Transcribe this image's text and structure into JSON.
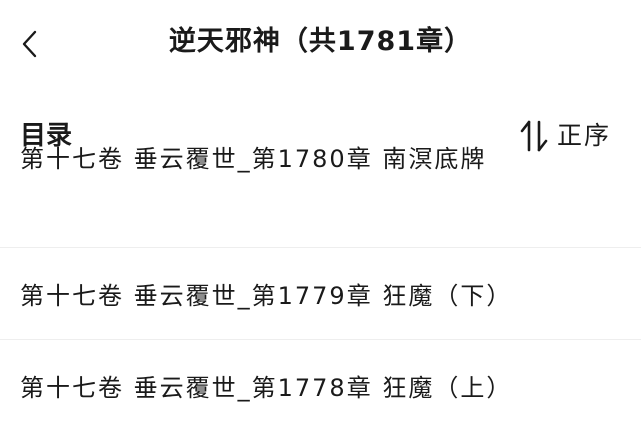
{
  "header": {
    "back_icon": "chevron-left-icon",
    "title": "逆天邪神（共1781章）"
  },
  "catalog": {
    "title": "目录",
    "sort_icon": "sort-arrows-icon",
    "sort_label": "正序"
  },
  "chapters": [
    {
      "label": "第十七卷 垂云覆世_第1780章 南溟底牌"
    },
    {
      "label": "第十七卷 垂云覆世_第1779章 狂魔（下）"
    },
    {
      "label": "第十七卷 垂云覆世_第1778章 狂魔（上）"
    }
  ]
}
